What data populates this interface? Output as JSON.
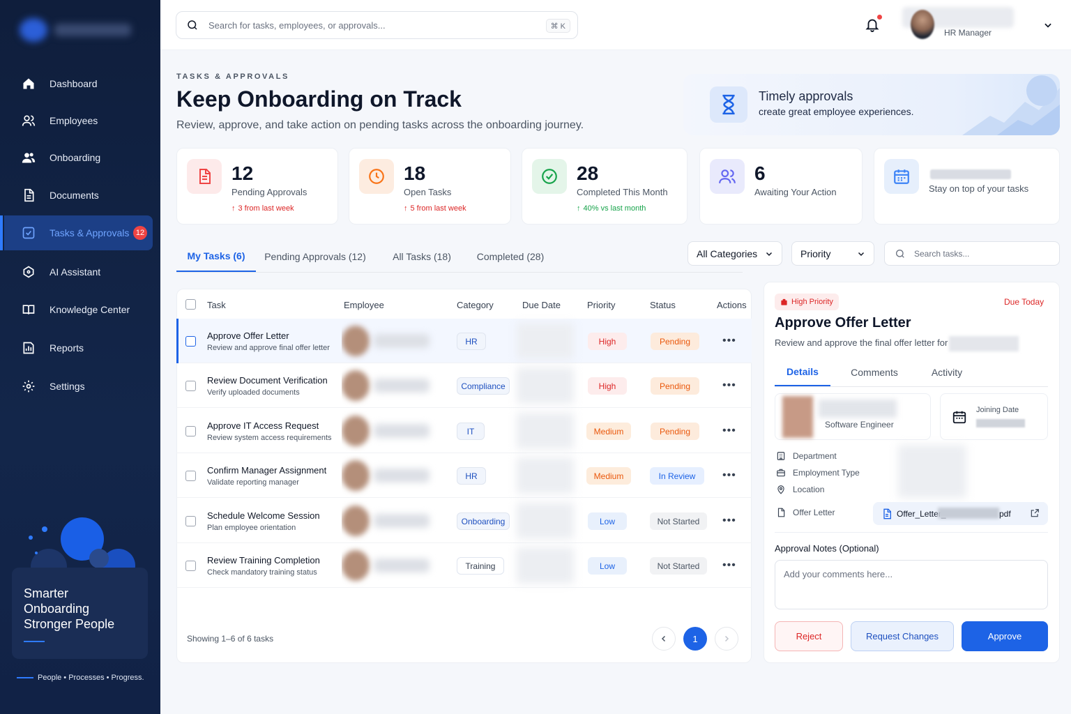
{
  "sidebar": {
    "items": [
      {
        "label": "Dashboard",
        "icon": "home-icon"
      },
      {
        "label": "Employees",
        "icon": "users-icon"
      },
      {
        "label": "Onboarding",
        "icon": "user-group-icon"
      },
      {
        "label": "Documents",
        "icon": "document-icon"
      },
      {
        "label": "Tasks & Approvals",
        "icon": "checkbox-icon",
        "badge": "12",
        "active": true
      },
      {
        "label": "AI Assistant",
        "icon": "ai-icon"
      },
      {
        "label": "Knowledge Center",
        "icon": "book-icon"
      },
      {
        "label": "Reports",
        "icon": "reports-icon"
      },
      {
        "label": "Settings",
        "icon": "gear-icon"
      }
    ],
    "promo": {
      "line1": "Smarter",
      "line2": "Onboarding",
      "line3": "Stronger People"
    },
    "tagline": "People • Processes • Progress."
  },
  "topbar": {
    "search_placeholder": "Search for tasks, employees, or approvals...",
    "shortcut": "⌘ K",
    "user_role": "HR Manager"
  },
  "header": {
    "eyebrow": "TASKS & APPROVALS",
    "title": "Keep Onboarding on Track",
    "subtitle": "Review, approve, and take action on pending tasks across the onboarding journey."
  },
  "banner": {
    "line1": "Timely approvals",
    "line2": "create great employee experiences."
  },
  "stats": [
    {
      "value": "12",
      "label": "Pending Approvals",
      "delta": "3 from last week",
      "color": "#ef4444"
    },
    {
      "value": "18",
      "label": "Open Tasks",
      "delta": "5 from last week",
      "color": "#f97316"
    },
    {
      "value": "28",
      "label": "Completed This Month",
      "delta": "40% vs last month",
      "color": "#16a34a"
    },
    {
      "value": "6",
      "label": "Awaiting Your Action",
      "color": "#6366f1"
    },
    {
      "label": "Stay on top of your tasks",
      "color": "#3b82f6"
    }
  ],
  "tabs": [
    "My Tasks (6)",
    "Pending Approvals (12)",
    "All Tasks (18)",
    "Completed (28)"
  ],
  "filters": {
    "category": "All Categories",
    "priority": "Priority",
    "search_placeholder": "Search tasks..."
  },
  "table": {
    "headers": [
      "Task",
      "Employee",
      "Category",
      "Due Date",
      "Priority",
      "Status",
      "Actions"
    ],
    "rows": [
      {
        "task": "Approve Offer Letter",
        "desc": "Review and approve final offer letter",
        "category": "HR",
        "priority": "High",
        "status": "Pending"
      },
      {
        "task": "Review Document Verification",
        "desc": "Verify uploaded documents",
        "category": "Compliance",
        "priority": "High",
        "status": "Pending"
      },
      {
        "task": "Approve IT Access Request",
        "desc": "Review system access requirements",
        "category": "IT",
        "priority": "Medium",
        "status": "Pending"
      },
      {
        "task": "Confirm Manager Assignment",
        "desc": "Validate reporting manager",
        "category": "HR",
        "priority": "Medium",
        "status": "In Review"
      },
      {
        "task": "Schedule Welcome Session",
        "desc": "Plan employee orientation",
        "category": "Onboarding",
        "priority": "Low",
        "status": "Not Started"
      },
      {
        "task": "Review Training Completion",
        "desc": "Check mandatory training status",
        "category": "Training",
        "priority": "Low",
        "status": "Not Started"
      }
    ],
    "actions_glyph": "•••",
    "showing": "Showing 1–6 of 6 tasks",
    "page": "1"
  },
  "detail": {
    "priority_badge": "High Priority",
    "due": "Due Today",
    "title": "Approve Offer Letter",
    "desc": "Review and approve the final offer letter for",
    "tabs": [
      "Details",
      "Comments",
      "Activity"
    ],
    "role": "Software Engineer",
    "joining_label": "Joining Date",
    "department_label": "Department",
    "employment_label": "Employment Type",
    "location_label": "Location",
    "offer_label": "Offer Letter",
    "file_prefix": "Offer_Letter_",
    "file_suffix": "pdf",
    "notes_label": "Approval Notes (Optional)",
    "notes_placeholder": "Add your comments here...",
    "reject": "Reject",
    "request_changes": "Request Changes",
    "approve": "Approve"
  },
  "colors": {
    "accent": "#1d63e6",
    "sidebar": "#0f1e3c",
    "danger": "#ef4444"
  }
}
